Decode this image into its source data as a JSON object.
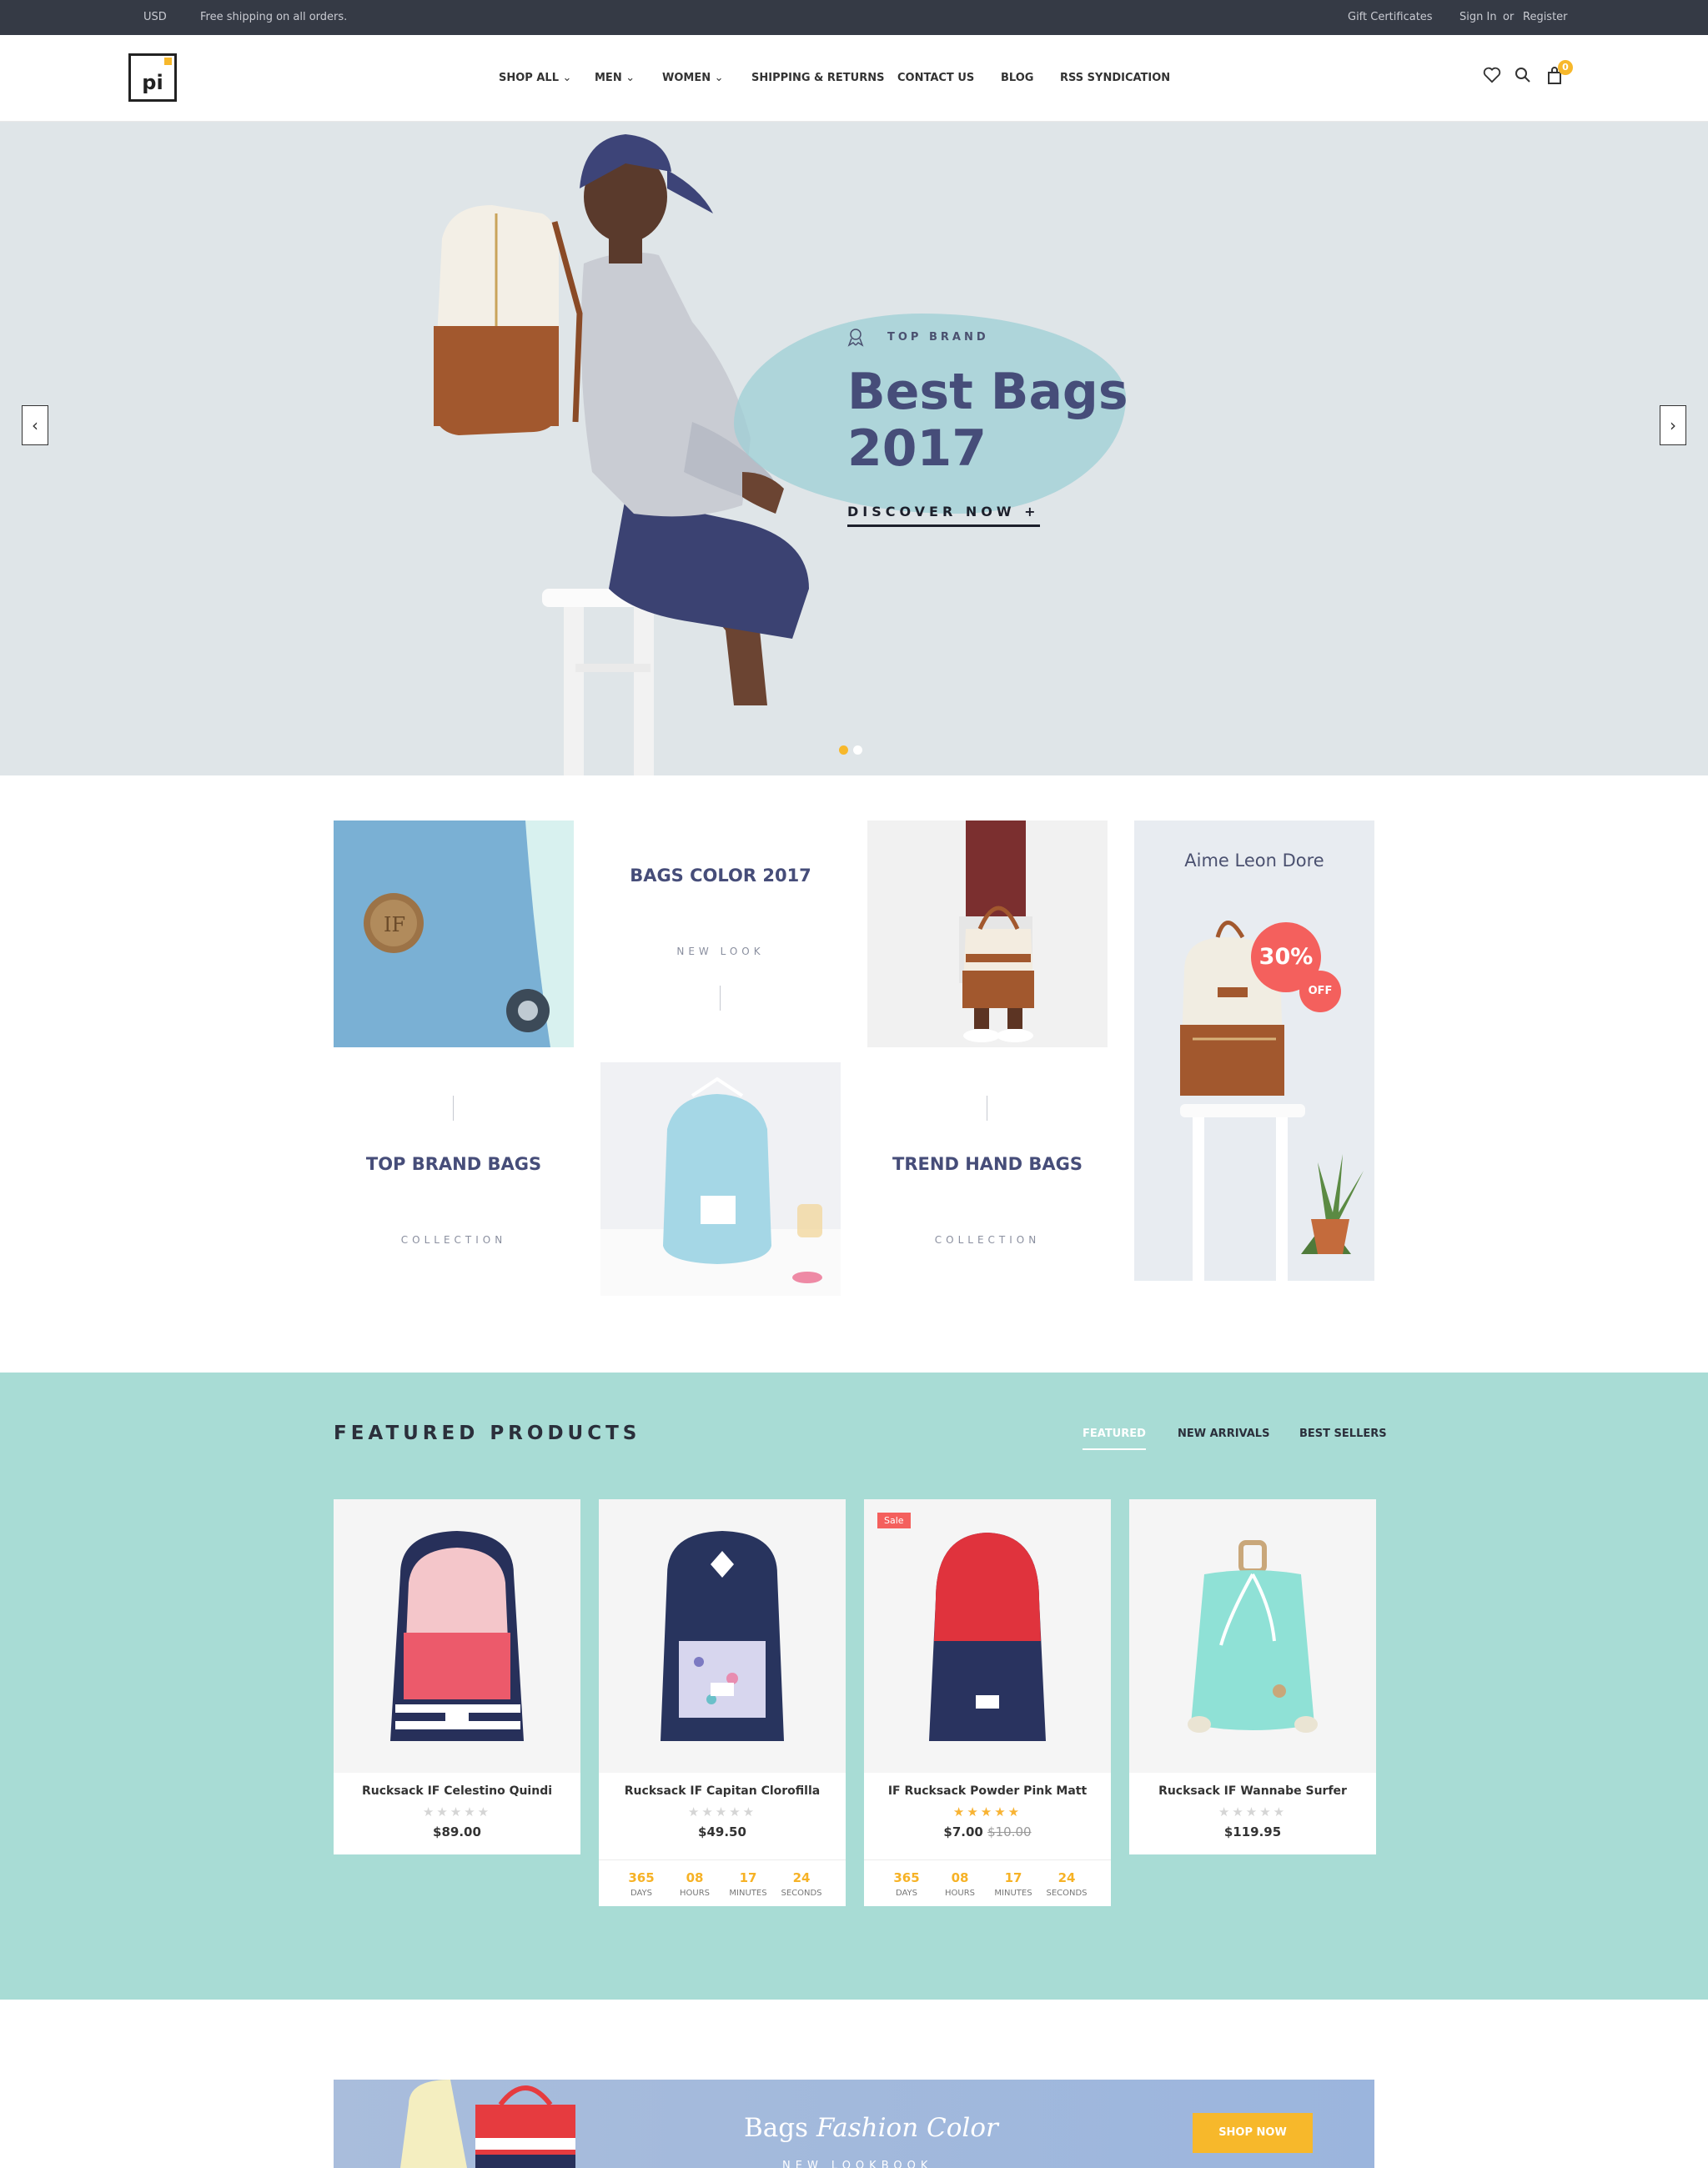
{
  "topbar": {
    "currency": "USD",
    "shipping": "Free shipping on all orders.",
    "gift": "Gift Certificates",
    "signin": "Sign In",
    "or": "or",
    "register": "Register"
  },
  "header": {
    "logo": "pi",
    "cart_count": "0"
  },
  "nav": [
    {
      "label": "SHOP ALL",
      "dropdown": true
    },
    {
      "label": "MEN",
      "dropdown": true
    },
    {
      "label": "WOMEN",
      "dropdown": true
    },
    {
      "label": "SHIPPING & RETURNS",
      "dropdown": false
    },
    {
      "label": "CONTACT US",
      "dropdown": false
    },
    {
      "label": "BLOG",
      "dropdown": false
    },
    {
      "label": "RSS SYNDICATION",
      "dropdown": false
    }
  ],
  "hero": {
    "subtitle": "TOP BRAND",
    "title": "Best Bags 2017",
    "cta": "DISCOVER NOW +",
    "slides": 2,
    "active_slide": 1
  },
  "collections": {
    "c1": {
      "title": "BAGS COLOR 2017",
      "sub": "NEW LOOK"
    },
    "c2": {
      "title": "TOP BRAND BAGS",
      "sub": "COLLECTION"
    },
    "c3": {
      "title": "TREND HAND BAGS",
      "sub": "COLLECTION"
    },
    "promo": {
      "title": "Aime Leon Dore",
      "discount": "30%",
      "off": "OFF"
    }
  },
  "featured": {
    "title": "FEATURED PRODUCTS",
    "tabs": [
      "FEATURED",
      "NEW ARRIVALS",
      "BEST SELLERS"
    ],
    "products": [
      {
        "name": "Rucksack IF Celestino Quindi",
        "price": "$89.00",
        "old_price": "",
        "rating": 0,
        "sale": "",
        "countdown": null
      },
      {
        "name": "Rucksack IF Capitan Clorofilla",
        "price": "$49.50",
        "old_price": "",
        "rating": 0,
        "sale": "",
        "countdown": {
          "days": "365",
          "hours": "08",
          "minutes": "17",
          "seconds": "24"
        }
      },
      {
        "name": "IF Rucksack Powder Pink Matt",
        "price": "$7.00",
        "old_price": "$10.00",
        "rating": 5,
        "sale": "Sale",
        "countdown": {
          "days": "365",
          "hours": "08",
          "minutes": "17",
          "seconds": "24"
        }
      },
      {
        "name": "Rucksack IF Wannabe Surfer",
        "price": "$119.95",
        "old_price": "",
        "rating": 0,
        "sale": "",
        "countdown": null
      }
    ],
    "countdown_labels": {
      "days": "DAYS",
      "hours": "HOURS",
      "minutes": "MINUTES",
      "seconds": "SECONDS"
    }
  },
  "banner": {
    "title_plain": "Bags",
    "title_italic": "Fashion Color",
    "sub": "NEW LOOKBOOK",
    "button": "SHOP NOW"
  },
  "colors": {
    "accent": "#f7b82b",
    "navy": "#464d79",
    "teal_section": "#a8dcd5",
    "topbar": "#353a45",
    "sale": "#f4605d"
  }
}
